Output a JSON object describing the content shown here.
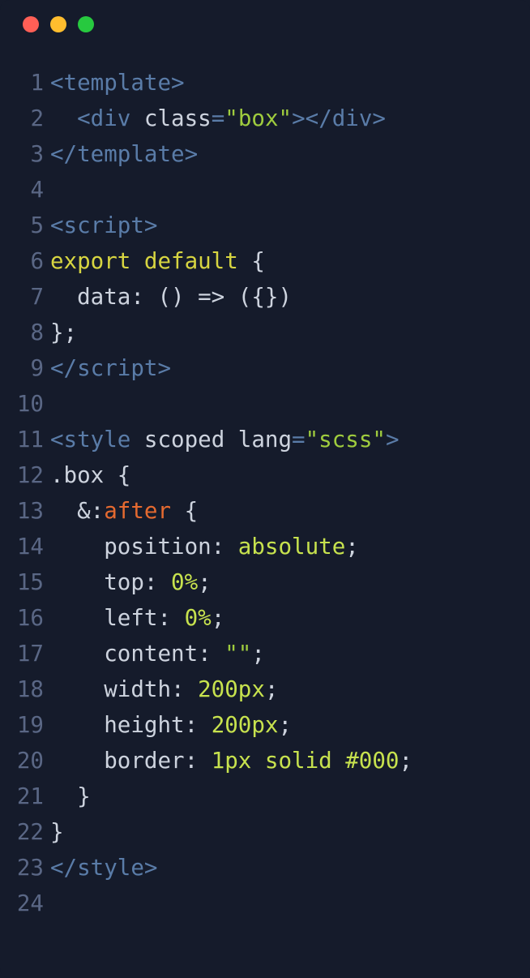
{
  "window": {
    "traffic_lights": [
      "red",
      "yellow",
      "green"
    ]
  },
  "code": {
    "lines": [
      {
        "num": "1",
        "tokens": [
          {
            "cls": "c-tag",
            "t": "<template>"
          }
        ]
      },
      {
        "num": "2",
        "tokens": [
          {
            "cls": "c-plain",
            "t": "  "
          },
          {
            "cls": "c-tag",
            "t": "<div "
          },
          {
            "cls": "c-attr",
            "t": "class"
          },
          {
            "cls": "c-tag",
            "t": "="
          },
          {
            "cls": "c-string",
            "t": "\"box\""
          },
          {
            "cls": "c-tag",
            "t": "></div>"
          }
        ]
      },
      {
        "num": "3",
        "tokens": [
          {
            "cls": "c-tag",
            "t": "</template>"
          }
        ]
      },
      {
        "num": "4",
        "tokens": [
          {
            "cls": "c-plain",
            "t": ""
          }
        ]
      },
      {
        "num": "5",
        "tokens": [
          {
            "cls": "c-tag",
            "t": "<script>"
          }
        ]
      },
      {
        "num": "6",
        "tokens": [
          {
            "cls": "c-keyword",
            "t": "export default"
          },
          {
            "cls": "c-plain",
            "t": " {"
          }
        ]
      },
      {
        "num": "7",
        "tokens": [
          {
            "cls": "c-plain",
            "t": "  data: () => ({})"
          }
        ]
      },
      {
        "num": "8",
        "tokens": [
          {
            "cls": "c-plain",
            "t": "};"
          }
        ]
      },
      {
        "num": "9",
        "tokens": [
          {
            "cls": "c-tag",
            "t": "</"
          },
          {
            "cls": "c-tag",
            "t": "script>"
          }
        ]
      },
      {
        "num": "10",
        "tokens": [
          {
            "cls": "c-plain",
            "t": ""
          }
        ]
      },
      {
        "num": "11",
        "tokens": [
          {
            "cls": "c-tag",
            "t": "<style "
          },
          {
            "cls": "c-attr",
            "t": "scoped lang"
          },
          {
            "cls": "c-tag",
            "t": "="
          },
          {
            "cls": "c-string",
            "t": "\"scss\""
          },
          {
            "cls": "c-tag",
            "t": ">"
          }
        ]
      },
      {
        "num": "12",
        "tokens": [
          {
            "cls": "c-plain",
            "t": ".box {"
          }
        ]
      },
      {
        "num": "13",
        "tokens": [
          {
            "cls": "c-plain",
            "t": "  &:"
          },
          {
            "cls": "c-pseudo",
            "t": "after"
          },
          {
            "cls": "c-plain",
            "t": " {"
          }
        ]
      },
      {
        "num": "14",
        "tokens": [
          {
            "cls": "c-plain",
            "t": "    position: "
          },
          {
            "cls": "c-val",
            "t": "absolute"
          },
          {
            "cls": "c-plain",
            "t": ";"
          }
        ]
      },
      {
        "num": "15",
        "tokens": [
          {
            "cls": "c-plain",
            "t": "    top: "
          },
          {
            "cls": "c-val",
            "t": "0%"
          },
          {
            "cls": "c-plain",
            "t": ";"
          }
        ]
      },
      {
        "num": "16",
        "tokens": [
          {
            "cls": "c-plain",
            "t": "    left: "
          },
          {
            "cls": "c-val",
            "t": "0%"
          },
          {
            "cls": "c-plain",
            "t": ";"
          }
        ]
      },
      {
        "num": "17",
        "tokens": [
          {
            "cls": "c-plain",
            "t": "    content: "
          },
          {
            "cls": "c-string",
            "t": "\"\""
          },
          {
            "cls": "c-plain",
            "t": ";"
          }
        ]
      },
      {
        "num": "18",
        "tokens": [
          {
            "cls": "c-plain",
            "t": "    width: "
          },
          {
            "cls": "c-val",
            "t": "200px"
          },
          {
            "cls": "c-plain",
            "t": ";"
          }
        ]
      },
      {
        "num": "19",
        "tokens": [
          {
            "cls": "c-plain",
            "t": "    height: "
          },
          {
            "cls": "c-val",
            "t": "200px"
          },
          {
            "cls": "c-plain",
            "t": ";"
          }
        ]
      },
      {
        "num": "20",
        "tokens": [
          {
            "cls": "c-plain",
            "t": "    border: "
          },
          {
            "cls": "c-val",
            "t": "1px solid #000"
          },
          {
            "cls": "c-plain",
            "t": ";"
          }
        ]
      },
      {
        "num": "21",
        "tokens": [
          {
            "cls": "c-plain",
            "t": "  }"
          }
        ]
      },
      {
        "num": "22",
        "tokens": [
          {
            "cls": "c-plain",
            "t": "}"
          }
        ]
      },
      {
        "num": "23",
        "tokens": [
          {
            "cls": "c-tag",
            "t": "</style>"
          }
        ]
      },
      {
        "num": "24",
        "tokens": [
          {
            "cls": "c-plain",
            "t": ""
          }
        ]
      }
    ]
  }
}
